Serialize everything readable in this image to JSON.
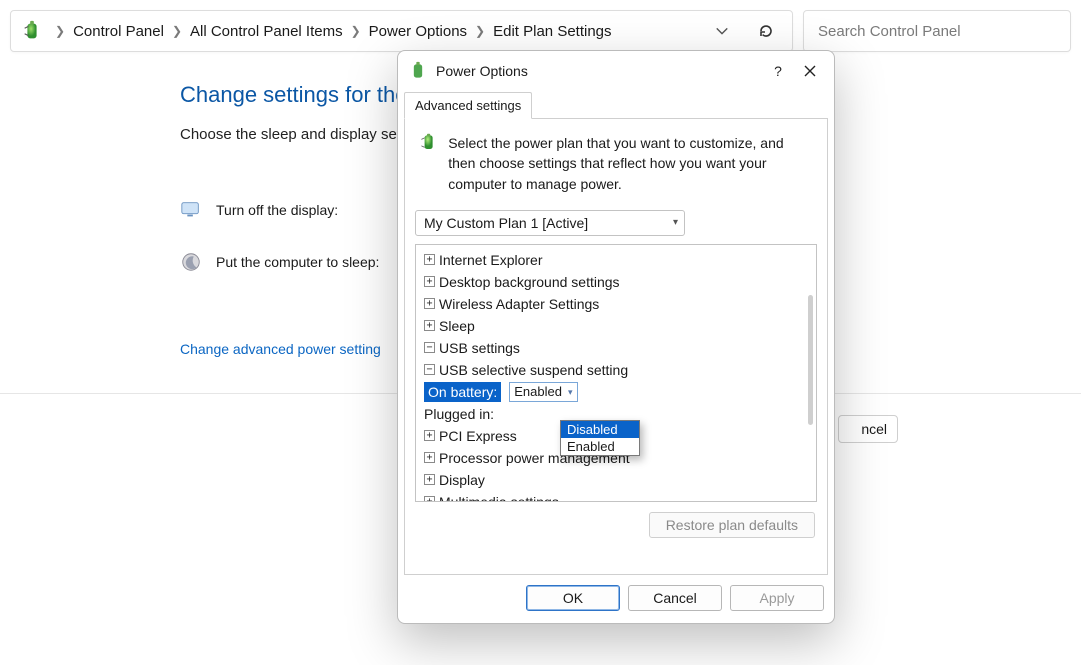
{
  "breadcrumbs": {
    "items": [
      "Control Panel",
      "All Control Panel Items",
      "Power Options",
      "Edit Plan Settings"
    ]
  },
  "search": {
    "placeholder": "Search Control Panel"
  },
  "page": {
    "title": "Change settings for the p",
    "subtitle": "Choose the sleep and display se",
    "row_display": "Turn off the display:",
    "row_sleep": "Put the computer to sleep:",
    "link_advanced": "Change advanced power setting"
  },
  "ghost_button": "ncel",
  "dialog": {
    "title": "Power Options",
    "tab": "Advanced settings",
    "intro": "Select the power plan that you want to customize, and then choose settings that reflect how you want your computer to manage power.",
    "plan": "My Custom Plan 1 [Active]",
    "tree": {
      "n0": "Internet Explorer",
      "n1": "Desktop background settings",
      "n2": "Wireless Adapter Settings",
      "n3": "Sleep",
      "n4": "USB settings",
      "n4a": "USB selective suspend setting",
      "n4a_bat_label": "On battery:",
      "n4a_bat_value": "Enabled",
      "n4a_plug_label": "Plugged in:",
      "n5": "PCI Express",
      "n6": "Processor power management",
      "n7": "Display",
      "n8": "Multimedia settings"
    },
    "dropdown": {
      "opt0": "Disabled",
      "opt1": "Enabled"
    },
    "restore": "Restore plan defaults",
    "ok": "OK",
    "cancel": "Cancel",
    "apply": "Apply"
  }
}
